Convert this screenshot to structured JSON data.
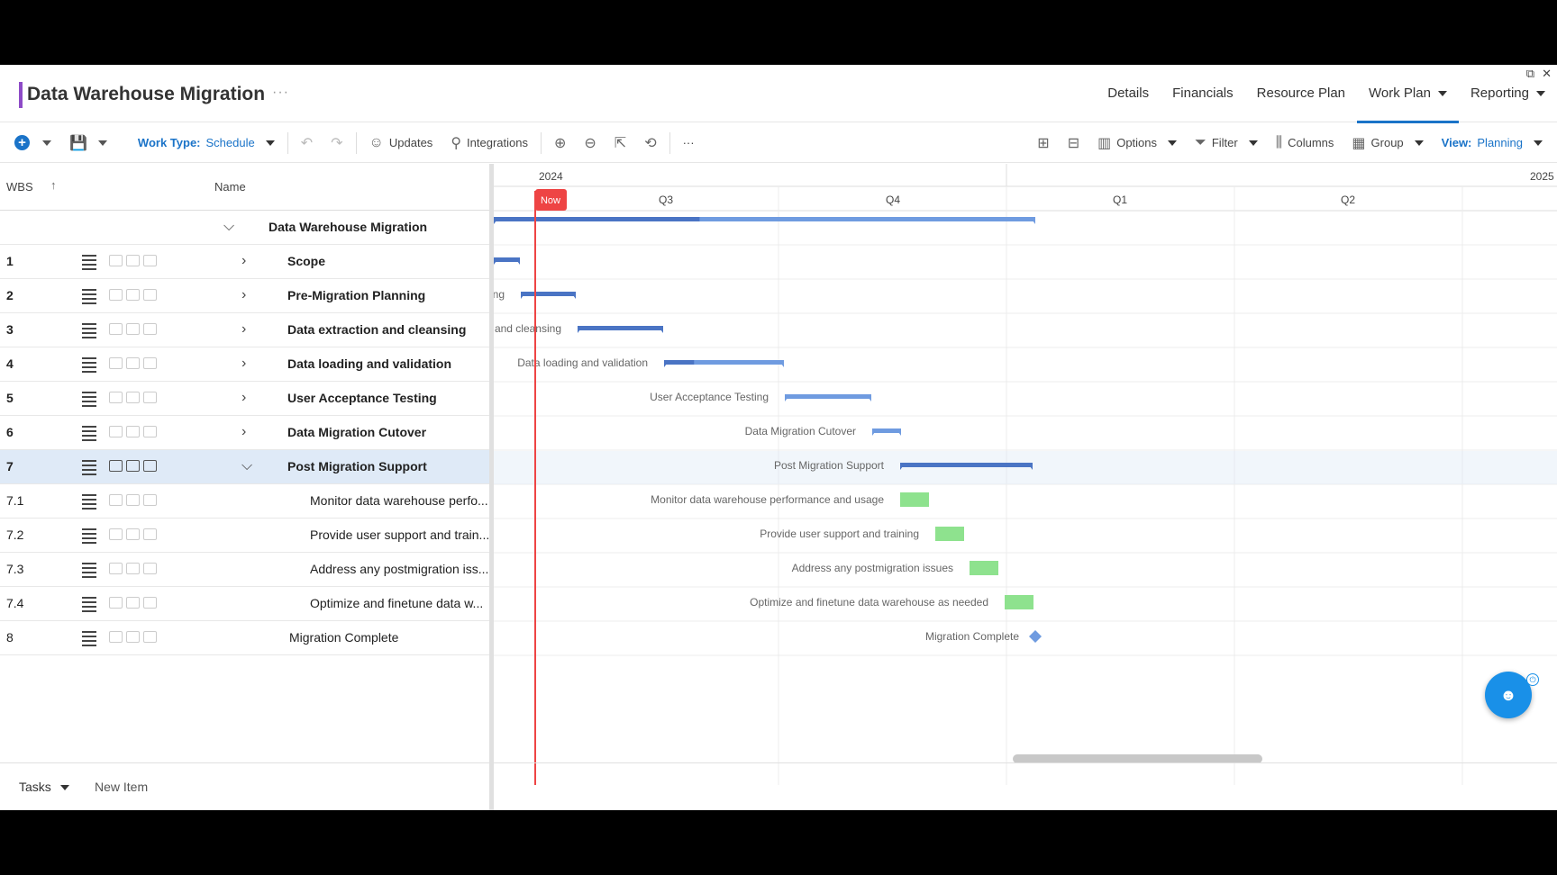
{
  "header": {
    "title": "Data Warehouse Migration",
    "more": "···",
    "nav": [
      {
        "label": "Details",
        "caret": false,
        "active": false
      },
      {
        "label": "Financials",
        "caret": false,
        "active": false
      },
      {
        "label": "Resource Plan",
        "caret": false,
        "active": false
      },
      {
        "label": "Work Plan",
        "caret": true,
        "active": true
      },
      {
        "label": "Reporting",
        "caret": true,
        "active": false
      }
    ]
  },
  "toolbar": {
    "work_type_label": "Work Type:",
    "work_type_value": "Schedule",
    "updates": "Updates",
    "integrations": "Integrations",
    "more": "···",
    "options": "Options",
    "filter": "Filter",
    "columns": "Columns",
    "group": "Group",
    "view_label": "View:",
    "view_value": "Planning"
  },
  "grid": {
    "col_wbs": "WBS",
    "col_name": "Name",
    "rows": [
      {
        "wbs": "",
        "name": "Data Warehouse Migration",
        "level": 0,
        "bold": true,
        "expander": "down",
        "menu": false
      },
      {
        "wbs": "1",
        "name": "Scope",
        "level": 1,
        "bold": true,
        "expander": "right",
        "menu": true
      },
      {
        "wbs": "2",
        "name": "Pre-Migration Planning",
        "level": 1,
        "bold": true,
        "expander": "right",
        "menu": true
      },
      {
        "wbs": "3",
        "name": "Data extraction and cleansing",
        "level": 1,
        "bold": true,
        "expander": "right",
        "menu": true
      },
      {
        "wbs": "4",
        "name": "Data loading and validation",
        "level": 1,
        "bold": true,
        "expander": "right",
        "menu": true
      },
      {
        "wbs": "5",
        "name": "User Acceptance Testing",
        "level": 1,
        "bold": true,
        "expander": "right",
        "menu": true
      },
      {
        "wbs": "6",
        "name": "Data Migration Cutover",
        "level": 1,
        "bold": true,
        "expander": "right",
        "menu": true
      },
      {
        "wbs": "7",
        "name": "Post Migration Support",
        "level": 1,
        "bold": true,
        "expander": "down",
        "menu": true,
        "selected": true
      },
      {
        "wbs": "7.1",
        "name": "Monitor data warehouse perfo...",
        "level": 2,
        "bold": false,
        "expander": "",
        "menu": true
      },
      {
        "wbs": "7.2",
        "name": "Provide user support and train...",
        "level": 2,
        "bold": false,
        "expander": "",
        "menu": true
      },
      {
        "wbs": "7.3",
        "name": "Address any postmigration iss...",
        "level": 2,
        "bold": false,
        "expander": "",
        "menu": true
      },
      {
        "wbs": "7.4",
        "name": "Optimize and finetune data w...",
        "level": 2,
        "bold": false,
        "expander": "",
        "menu": true
      },
      {
        "wbs": "8",
        "name": "Migration Complete",
        "level": 1,
        "bold": false,
        "expander": "",
        "menu": true
      }
    ]
  },
  "gantt": {
    "years": [
      "2024",
      "2025"
    ],
    "quarters": [
      "Q3",
      "Q4",
      "Q1",
      "Q2"
    ],
    "now_label": "Now",
    "colors": {
      "summary": "#6f9be0",
      "task": "#8ee28e",
      "now": "#ee4444",
      "milestone": "#6f9be0"
    },
    "bars": [
      {
        "label": "",
        "kind": "summary",
        "progress": 0.38
      },
      {
        "label": "",
        "kind": "summary",
        "progress": 1.0
      },
      {
        "label": "ng",
        "kind": "summary",
        "progress": 1.0
      },
      {
        "label": "and cleansing",
        "kind": "summary",
        "progress": 1.0
      },
      {
        "label": "Data loading and validation",
        "kind": "summary",
        "progress": 0.25
      },
      {
        "label": "User Acceptance Testing",
        "kind": "summary",
        "progress": 0.0
      },
      {
        "label": "Data Migration Cutover",
        "kind": "summary",
        "progress": 0.0
      },
      {
        "label": "Post Migration Support",
        "kind": "summary",
        "progress": 1.0
      },
      {
        "label": "Monitor data warehouse performance and usage",
        "kind": "task",
        "progress": 0.0
      },
      {
        "label": "Provide user support and training",
        "kind": "task",
        "progress": 0.0
      },
      {
        "label": "Address any postmigration issues",
        "kind": "task",
        "progress": 0.0
      },
      {
        "label": "Optimize and finetune data warehouse as needed",
        "kind": "task",
        "progress": 0.0
      },
      {
        "label": "Migration Complete",
        "kind": "milestone",
        "progress": 0.0
      }
    ]
  },
  "footer": {
    "tasks": "Tasks",
    "new_item": "New Item"
  }
}
